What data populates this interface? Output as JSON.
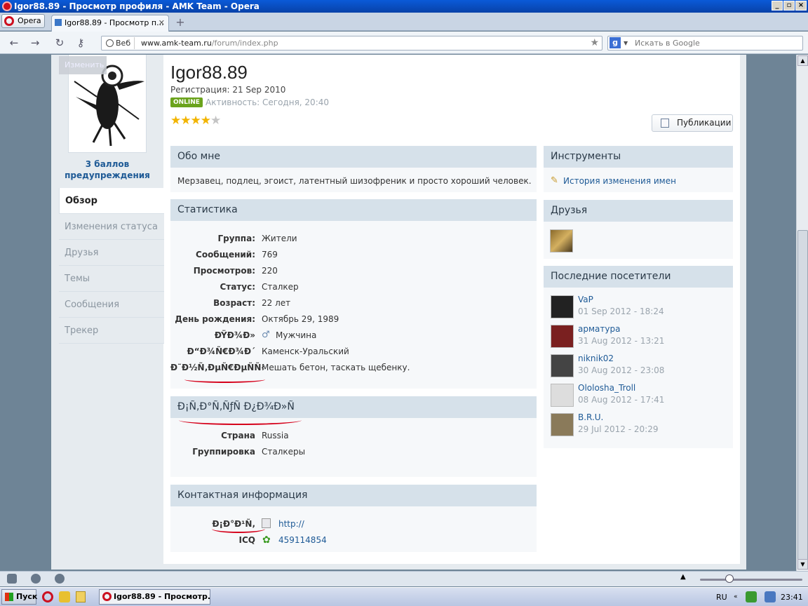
{
  "window": {
    "title": "Igor88.89 - Просмотр профиля - AMK Team - Opera"
  },
  "browser": {
    "menu_label": "Opera",
    "tab_title": "Igor88.89 - Просмотр п...",
    "web_badge": "Веб",
    "url_host": "www.amk-team.ru",
    "url_path": "/forum/index.php",
    "search_placeholder": "Искать в Google"
  },
  "profile": {
    "name": "Igor88.89",
    "registration": "Регистрация: 21 Sep 2010",
    "online_badge": "ONLINE",
    "activity": "Активность: Сегодня, 20:40",
    "rating_stars": 4,
    "rating_max": 5,
    "publications_button": "Публикации",
    "edit_avatar": "Изменить",
    "warnings": "3 баллов предупреждения"
  },
  "left_nav": [
    "Обзор",
    "Изменения статуса",
    "Друзья",
    "Темы",
    "Сообщения",
    "Трекер"
  ],
  "about": {
    "title": "Обо мне",
    "text": "Мерзавец, подлец, эгоист, латентный шизофреник и просто хороший человек."
  },
  "stats": {
    "title": "Статистика",
    "rows": [
      {
        "label": "Группа:",
        "value": "Жители"
      },
      {
        "label": "Сообщений:",
        "value": "769"
      },
      {
        "label": "Просмотров:",
        "value": "220"
      },
      {
        "label": "Статус:",
        "value": "Сталкер"
      },
      {
        "label": "Возраст:",
        "value": "22 лет"
      },
      {
        "label": "День рождения:",
        "value": "Октябрь 29, 1989"
      },
      {
        "label": "ÐŸÐ¾Ð»",
        "value": "Мужчина"
      },
      {
        "label": "Ð“Ð¾Ñ€Ð¾Ð´",
        "value": "Каменск-Уральский"
      },
      {
        "label": "Ð˜Ð½Ñ‚ÐµÑ€ÐµÑÑ‹",
        "value": "Мешать бетон, таскать щебенку."
      }
    ]
  },
  "stalker": {
    "title": "Ð¡Ñ‚Ð°Ñ‚ÑƒÑ Ð¿Ð¾Ð»Ñ",
    "rows": [
      {
        "label": "Страна",
        "value": "Russia"
      },
      {
        "label": "Группировка",
        "value": "Сталкеры"
      }
    ]
  },
  "contact": {
    "title": "Контактная информация",
    "rows": [
      {
        "label": "Ð¡Ð°Ð¹Ñ‚",
        "value": "http://"
      },
      {
        "label": "ICQ",
        "value": "459114854"
      }
    ]
  },
  "tools": {
    "title": "Инструменты",
    "link": "История изменения имен"
  },
  "friends": {
    "title": "Друзья"
  },
  "visitors": {
    "title": "Последние посетители",
    "items": [
      {
        "name": "VaP",
        "date": "01 Sep 2012 - 18:24"
      },
      {
        "name": "арматура",
        "date": "31 Aug 2012 - 13:21"
      },
      {
        "name": "niknik02",
        "date": "30 Aug 2012 - 23:08"
      },
      {
        "name": "Ololosha_Troll",
        "date": "08 Aug 2012 - 17:41"
      },
      {
        "name": "B.R.U.",
        "date": "29 Jul 2012 - 20:29"
      }
    ]
  },
  "taskbar": {
    "start": "Пуск",
    "item": "Igor88.89 - Просмотр...",
    "lang": "RU",
    "clock": "23:41"
  },
  "colors": {
    "accent": "#1e5a96",
    "online": "#6ba31c",
    "box_header": "#d6e1ea",
    "annotation": "#d5001a"
  }
}
